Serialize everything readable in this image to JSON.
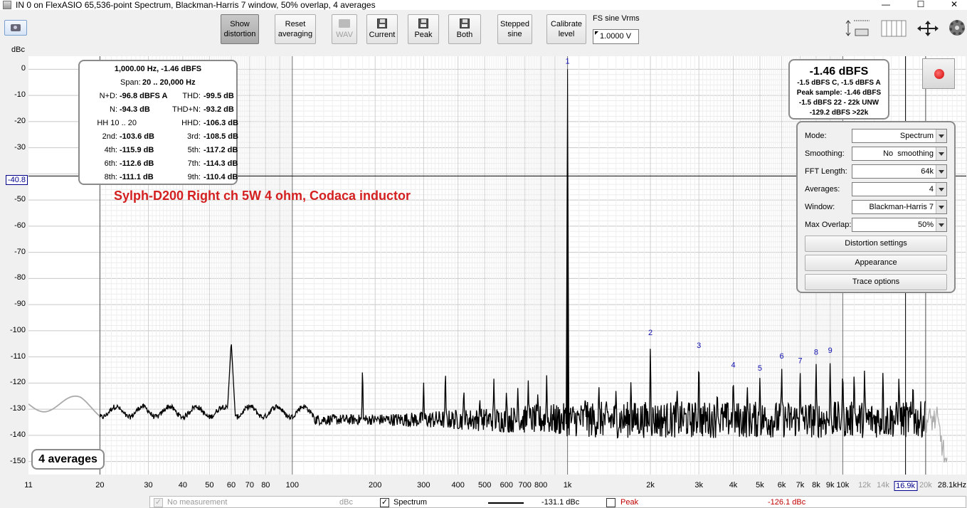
{
  "window": {
    "title": "IN 0 on FlexASIO 65,536-point Spectrum, Blackman-Harris 7 window, 50% overlap, 4 averages",
    "min": "—",
    "max": "☐",
    "close": "✕"
  },
  "toolbar": {
    "show_distortion": [
      "Show",
      "distortion"
    ],
    "reset_averaging": [
      "Reset",
      "averaging"
    ],
    "wav": "WAV",
    "current": "Current",
    "peak": "Peak",
    "both": "Both",
    "stepped_sine": [
      "Stepped",
      "sine"
    ],
    "calibrate_level": [
      "Calibrate",
      "level"
    ],
    "fs_label": "FS sine Vrms",
    "fs_value": "1.0000 V"
  },
  "icons": [
    "camera-icon",
    "scale-icon",
    "columns-icon",
    "move-icon",
    "gear-icon",
    "floppy-icon",
    "folder-icon"
  ],
  "axis": {
    "y_unit": "dBc",
    "y_ticks": [
      "0",
      "-10",
      "-20",
      "-30",
      "-50",
      "-60",
      "-70",
      "-80",
      "-90",
      "-100",
      "-110",
      "-120",
      "-130",
      "-140",
      "-150"
    ],
    "y_cursor": "-40.8",
    "x_ticks": [
      "11",
      "20",
      "30",
      "40",
      "50",
      "60",
      "70",
      "80",
      "100",
      "200",
      "300",
      "400",
      "500",
      "600",
      "700",
      "800",
      "1k",
      "2k",
      "3k",
      "4k",
      "5k",
      "6k",
      "7k",
      "8k",
      "9k",
      "10k",
      "12k",
      "14k",
      "20k",
      "28.1kHz"
    ],
    "x_cursor": "16.9k"
  },
  "readout": {
    "header": "1,000.00 Hz, -1.46 dBFS",
    "span_label": "Span:",
    "span_value": "20 .. 20,000 Hz",
    "rows": [
      [
        "N+D:",
        "-96.8 dBFS A",
        "THD:",
        "-99.5 dB"
      ],
      [
        "N:",
        "-94.3 dB",
        "THD+N:",
        "-93.2 dB"
      ],
      [
        "HH 10 .. 20",
        "",
        "HHD:",
        "-106.3 dB"
      ],
      [
        "2nd:",
        "-103.6 dB",
        "3rd:",
        "-108.5 dB"
      ],
      [
        "4th:",
        "-115.9 dB",
        "5th:",
        "-117.2 dB"
      ],
      [
        "6th:",
        "-112.6 dB",
        "7th:",
        "-114.3 dB"
      ],
      [
        "8th:",
        "-111.1 dB",
        "9th:",
        "-110.4 dB"
      ]
    ]
  },
  "trace_title": "Sylph-D200 Right ch 5W 4 ohm, Codaca inductor",
  "level": {
    "main": "-1.46 dBFS",
    "lines": [
      "-1.5 dBFS C, -1.5 dBFS A",
      "Peak sample: -1.46 dBFS",
      "-1.5 dBFS 22 - 22k UNW",
      "-129.2 dBFS >22k"
    ]
  },
  "settings": {
    "rows": [
      {
        "label": "Mode:",
        "value": "Spectrum"
      },
      {
        "label": "Smoothing:",
        "value": "No  smoothing"
      },
      {
        "label": "FFT Length:",
        "value": "64k"
      },
      {
        "label": "Averages:",
        "value": "4"
      },
      {
        "label": "Window:",
        "value": "Blackman-Harris 7"
      },
      {
        "label": "Max Overlap:",
        "value": "50%"
      }
    ],
    "buttons": [
      "Distortion settings",
      "Appearance",
      "Trace options"
    ]
  },
  "averages_badge": "4 averages",
  "legend": {
    "no_measurement": "No measurement",
    "unit": "dBc",
    "spectrum": "Spectrum",
    "spectrum_value": "-131.1 dBc",
    "peak": "Peak",
    "peak_value": "-126.1 dBc"
  },
  "chart_data": {
    "type": "line",
    "x_scale": "log",
    "xlim": [
      11,
      28100
    ],
    "ylim": [
      -155,
      5
    ],
    "noise_floor": -134,
    "fundamental": {
      "freq": 1000,
      "level": 0,
      "label": "1"
    },
    "harmonics": [
      {
        "label": "2",
        "freq": 2000,
        "level": -103.6
      },
      {
        "label": "3",
        "freq": 3000,
        "level": -108.5
      },
      {
        "label": "4",
        "freq": 4000,
        "level": -115.9
      },
      {
        "label": "5",
        "freq": 5000,
        "level": -117.2
      },
      {
        "label": "6",
        "freq": 6000,
        "level": -112.6
      },
      {
        "label": "7",
        "freq": 7000,
        "level": -114.3
      },
      {
        "label": "8",
        "freq": 8000,
        "level": -111.1
      },
      {
        "label": "9",
        "freq": 9000,
        "level": -110.4
      }
    ],
    "spurs": [
      {
        "freq": 60,
        "level": -104
      },
      {
        "freq": 180,
        "level": -112
      },
      {
        "freq": 300,
        "level": -119
      },
      {
        "freq": 360,
        "level": -113
      },
      {
        "freq": 420,
        "level": -121
      },
      {
        "freq": 480,
        "level": -125
      },
      {
        "freq": 540,
        "level": -118
      },
      {
        "freq": 600,
        "level": -122
      },
      {
        "freq": 660,
        "level": -121
      },
      {
        "freq": 720,
        "level": -119
      },
      {
        "freq": 780,
        "level": -123
      },
      {
        "freq": 840,
        "level": -117
      },
      {
        "freq": 1160,
        "level": -124
      },
      {
        "freq": 1300,
        "level": -120
      },
      {
        "freq": 1500,
        "level": -122
      },
      {
        "freq": 1700,
        "level": -118
      },
      {
        "freq": 2500,
        "level": -121
      },
      {
        "freq": 3500,
        "level": -122
      },
      {
        "freq": 4500,
        "level": -120
      },
      {
        "freq": 10000,
        "level": -113
      },
      {
        "freq": 11000,
        "level": -114
      },
      {
        "freq": 12000,
        "level": -113
      },
      {
        "freq": 14000,
        "level": -114
      },
      {
        "freq": 16000,
        "level": -116
      },
      {
        "freq": 18000,
        "level": -118
      },
      {
        "freq": 20000,
        "level": -121
      }
    ],
    "cursor": {
      "freq": 16900,
      "level": -40.8
    }
  }
}
